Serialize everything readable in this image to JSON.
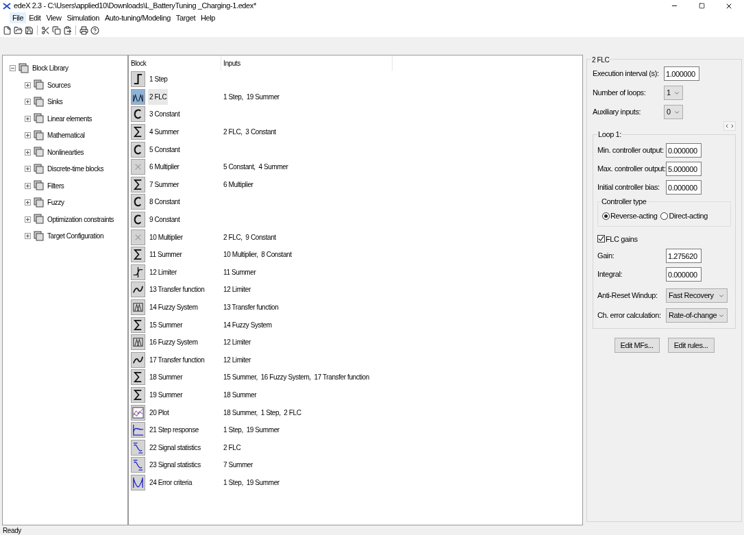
{
  "window": {
    "title": "edeX 2.3 - C:\\Users\\applied10\\Downloads\\L_BatteryTuning _Charging-1.edex*"
  },
  "menu": [
    {
      "label": "File",
      "selected": true
    },
    {
      "label": "Edit",
      "selected": false
    },
    {
      "label": "View",
      "selected": false
    },
    {
      "label": "Simulation",
      "selected": false
    },
    {
      "label": "Auto-tuning/Modeling",
      "selected": false
    },
    {
      "label": "Target",
      "selected": false
    },
    {
      "label": "Help",
      "selected": false
    }
  ],
  "tree": {
    "label": "Block Library",
    "expanded": true,
    "children": [
      {
        "label": "Sources",
        "expanded": false
      },
      {
        "label": "Sinks",
        "expanded": false
      },
      {
        "label": "Linear elements",
        "expanded": false
      },
      {
        "label": "Mathematical",
        "expanded": false
      },
      {
        "label": "Nonlinearties",
        "expanded": false
      },
      {
        "label": "Discrete-time blocks",
        "expanded": false
      },
      {
        "label": "Filters",
        "expanded": false
      },
      {
        "label": "Fuzzy",
        "expanded": false
      },
      {
        "label": "Optimization constraints",
        "expanded": false
      },
      {
        "label": "Target Configuration",
        "expanded": false
      }
    ]
  },
  "table": {
    "columns": [
      "Block",
      "Inputs"
    ],
    "rows": [
      {
        "kind": "step",
        "block": "1 Step",
        "inputs": "",
        "selected": false
      },
      {
        "kind": "flc",
        "block": "2 FLC",
        "inputs": "1 Step,  19 Summer",
        "selected": true
      },
      {
        "kind": "constant",
        "block": "3 Constant",
        "inputs": "",
        "selected": false
      },
      {
        "kind": "summer",
        "block": "4 Summer",
        "inputs": "2 FLC,  3 Constant",
        "selected": false
      },
      {
        "kind": "constant",
        "block": "5 Constant",
        "inputs": "",
        "selected": false
      },
      {
        "kind": "multiplier",
        "block": "6 Multiplier",
        "inputs": "5 Constant,  4 Summer",
        "selected": false
      },
      {
        "kind": "summer",
        "block": "7 Summer",
        "inputs": "6 Multiplier",
        "selected": false
      },
      {
        "kind": "constant",
        "block": "8 Constant",
        "inputs": "",
        "selected": false
      },
      {
        "kind": "constant",
        "block": "9 Constant",
        "inputs": "",
        "selected": false
      },
      {
        "kind": "multiplier",
        "block": "10 Multiplier",
        "inputs": "2 FLC,  9 Constant",
        "selected": false
      },
      {
        "kind": "summer",
        "block": "11 Summer",
        "inputs": "10 Multiplier,  8 Constant",
        "selected": false
      },
      {
        "kind": "limiter",
        "block": "12 Limiter",
        "inputs": "11 Summer",
        "selected": false
      },
      {
        "kind": "tf",
        "block": "13 Transfer function",
        "inputs": "12 Limiter",
        "selected": false
      },
      {
        "kind": "fuzzy",
        "block": "14 Fuzzy System",
        "inputs": "13 Transfer function",
        "selected": false
      },
      {
        "kind": "summer",
        "block": "15 Summer",
        "inputs": "14 Fuzzy System",
        "selected": false
      },
      {
        "kind": "fuzzy",
        "block": "16 Fuzzy System",
        "inputs": "12 Limiter",
        "selected": false
      },
      {
        "kind": "tf",
        "block": "17 Transfer function",
        "inputs": "12 Limiter",
        "selected": false
      },
      {
        "kind": "summer",
        "block": "18 Summer",
        "inputs": "15 Summer,  16 Fuzzy System,  17 Transfer function",
        "selected": false
      },
      {
        "kind": "summer",
        "block": "19 Summer",
        "inputs": "18 Summer",
        "selected": false
      },
      {
        "kind": "plot",
        "block": "20 Plot",
        "inputs": "18 Summer,  1 Step,  2 FLC",
        "selected": false
      },
      {
        "kind": "stepresponse",
        "block": "21 Step response",
        "inputs": "1 Step,  19 Summer",
        "selected": false
      },
      {
        "kind": "statistics",
        "block": "22 Signal statistics",
        "inputs": "2 FLC",
        "selected": false
      },
      {
        "kind": "statistics",
        "block": "23 Signal statistics",
        "inputs": "7 Summer",
        "selected": false
      },
      {
        "kind": "error",
        "block": "24 Error criteria",
        "inputs": "1 Step,  19 Summer",
        "selected": false
      }
    ]
  },
  "properties": {
    "title": "2 FLC",
    "execution_interval": {
      "label": "Execution interval (s):",
      "value": "1.000000"
    },
    "number_of_loops": {
      "label": "Number of loops:",
      "value": "1"
    },
    "auxiliary_inputs": {
      "label": "Auxiliary inputs:",
      "value": "0"
    },
    "loop": {
      "title": "Loop 1:",
      "min_output": {
        "label": "Min. controller output:",
        "value": "0.000000"
      },
      "max_output": {
        "label": "Max. controller output:",
        "value": "5.000000"
      },
      "initial_bias": {
        "label": "Initial controller bias:",
        "value": "0.000000"
      },
      "controller_type": {
        "title": "Controller type",
        "options": [
          {
            "label": "Reverse-acting",
            "selected": true
          },
          {
            "label": "Direct-acting",
            "selected": false
          }
        ]
      },
      "flc_gains": {
        "label": "FLC gains",
        "checked": true
      },
      "gain": {
        "label": "Gain:",
        "value": "1.275620"
      },
      "integral": {
        "label": "Integral:",
        "value": "0.000000"
      },
      "anti_reset_windup": {
        "label": "Anti-Reset Windup:",
        "value": "Fast Recovery"
      },
      "ch_error_calculation": {
        "label": "Ch. error calculation:",
        "value": "Rate-of-change"
      }
    },
    "buttons": [
      "Edit MFs...",
      "Edit rules..."
    ]
  },
  "status_bar": "Ready"
}
